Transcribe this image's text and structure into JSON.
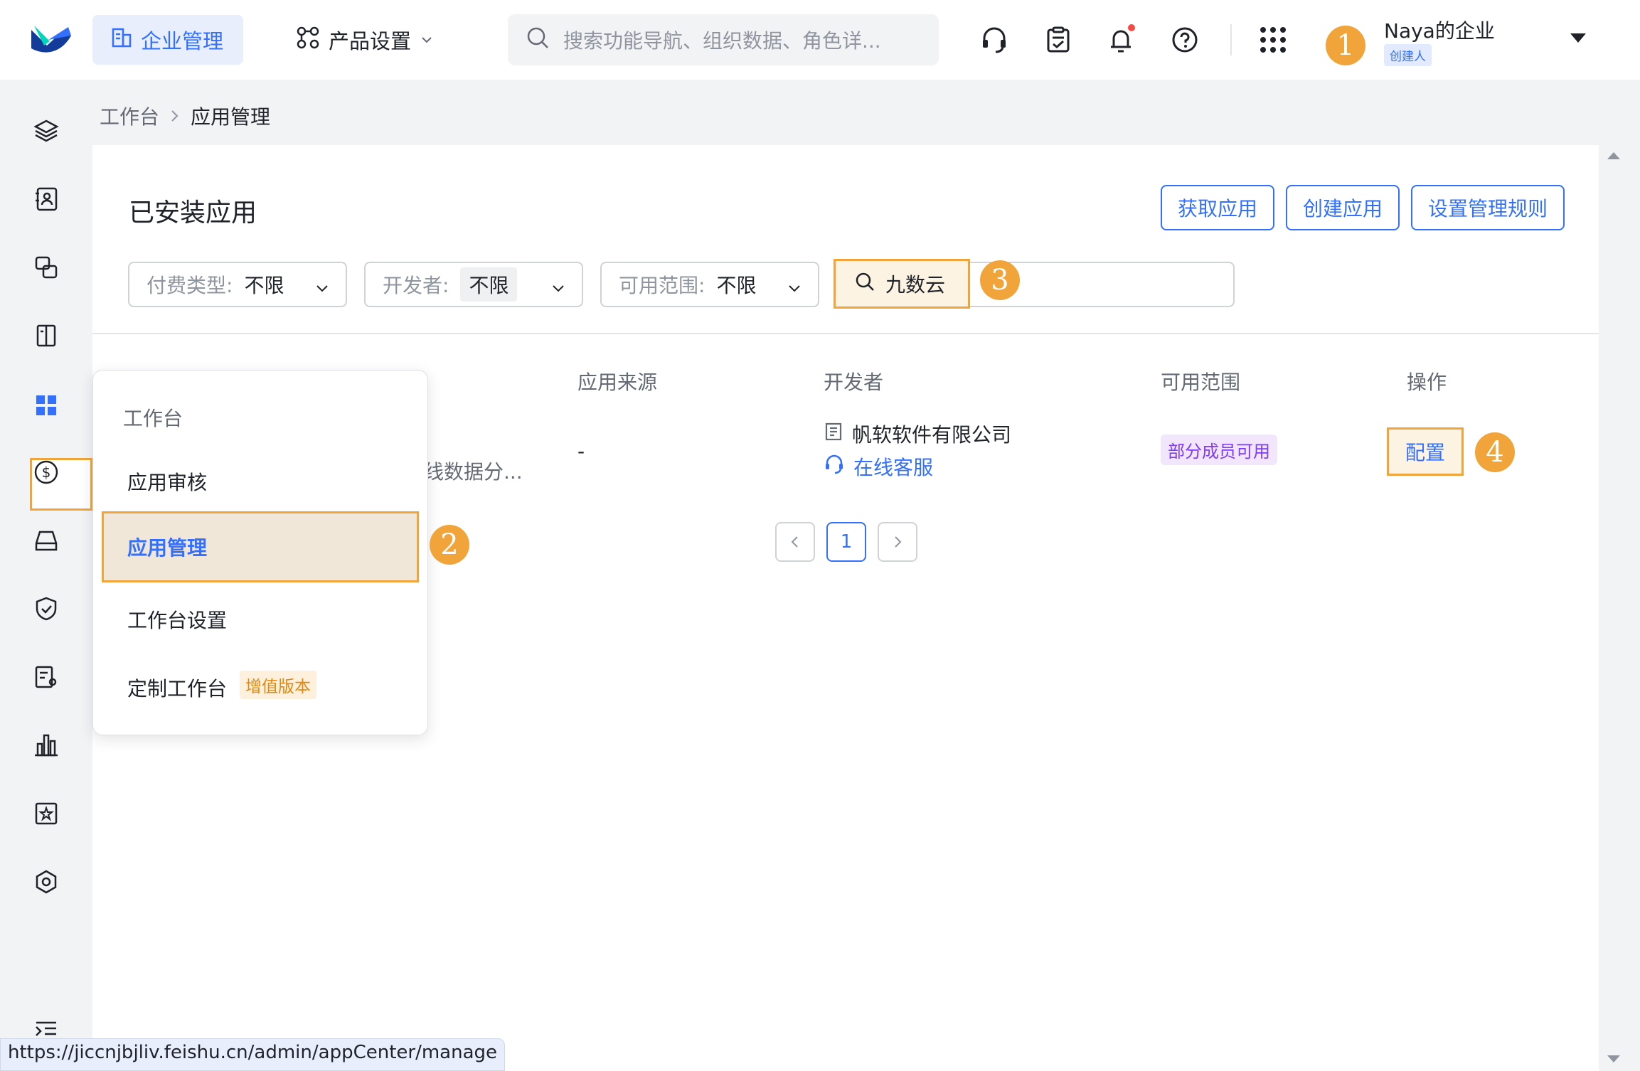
{
  "topbar": {
    "nav_active_label": "企业管理",
    "nav_product_label": "产品设置",
    "search_placeholder": "搜索功能导航、组织数据、角色详...",
    "org_name": "Naya的企业",
    "org_role": "创建人",
    "callout": "1"
  },
  "breadcrumb": {
    "root": "工作台",
    "current": "应用管理"
  },
  "page": {
    "title": "已安装应用",
    "buttons": [
      "获取应用",
      "创建应用",
      "设置管理规则"
    ]
  },
  "filters": [
    {
      "label": "付费类型:",
      "value": "不限"
    },
    {
      "label": "开发者:",
      "value": "不限"
    },
    {
      "label": "可用范围:",
      "value": "不限"
    }
  ],
  "search": {
    "value": "九数云",
    "callout": "3"
  },
  "table": {
    "headers": [
      "应用来源",
      "开发者",
      "可用范围",
      "操作"
    ],
    "row": {
      "desc_fragment": "线数据分...",
      "source": "-",
      "developer": "帆软软件有限公司",
      "support": "在线客服",
      "scope": "部分成员可用",
      "action": "配置",
      "callout": "4"
    }
  },
  "pagination": {
    "current": "1"
  },
  "menu": {
    "header": "工作台",
    "items": [
      "应用审核",
      "应用管理",
      "工作台设置",
      "定制工作台"
    ],
    "vip_tag": "增值版本",
    "callout_sidebar": "1",
    "callout_item": "2"
  },
  "status_url": "https://jiccnjbjliv.feishu.cn/admin/appCenter/manage",
  "colors": {
    "primary": "#3370ff",
    "highlight": "#f0a43a",
    "purple_tag": "#7f3bf5"
  }
}
